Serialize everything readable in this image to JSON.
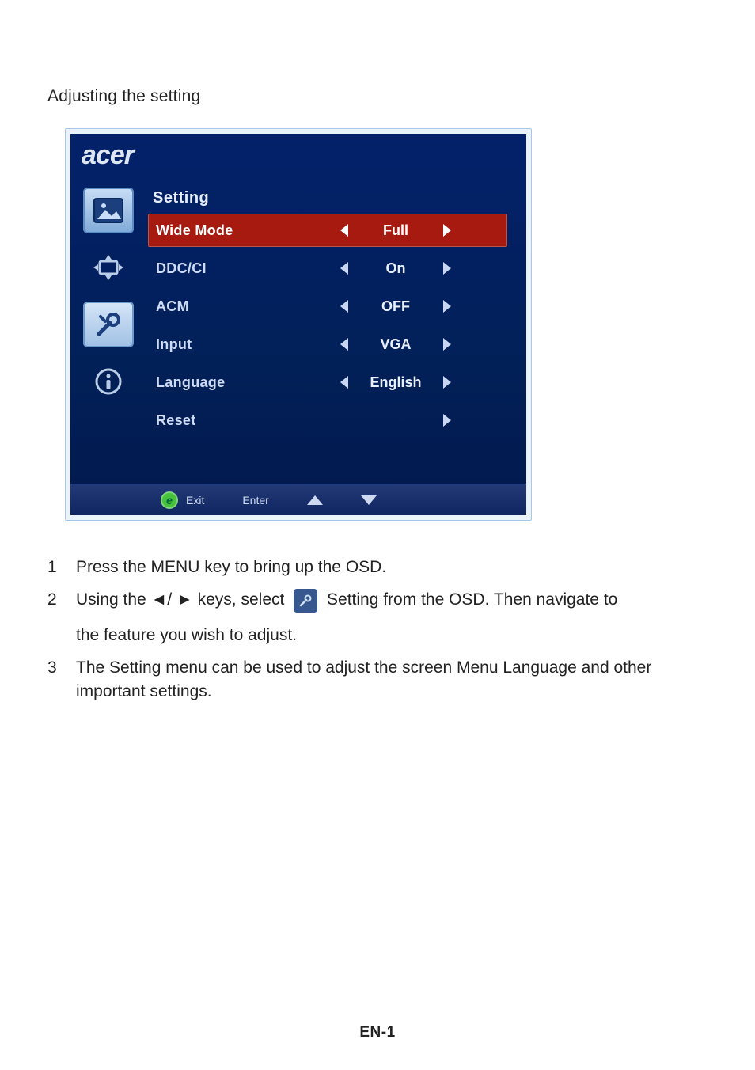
{
  "heading": "Adjusting the setting",
  "osd": {
    "brand": "acer",
    "menuTitle": "Setting",
    "rows": [
      {
        "label": "Wide Mode",
        "value": "Full",
        "hasLeft": true,
        "hasRight": true,
        "highlight": true
      },
      {
        "label": "DDC/CI",
        "value": "On",
        "hasLeft": true,
        "hasRight": true,
        "highlight": false
      },
      {
        "label": "ACM",
        "value": "OFF",
        "hasLeft": true,
        "hasRight": true,
        "highlight": false
      },
      {
        "label": "Input",
        "value": "VGA",
        "hasLeft": true,
        "hasRight": true,
        "highlight": false
      },
      {
        "label": "Language",
        "value": "English",
        "hasLeft": true,
        "hasRight": true,
        "highlight": false
      },
      {
        "label": "Reset",
        "value": "",
        "hasLeft": false,
        "hasRight": true,
        "highlight": false
      }
    ],
    "footer": {
      "exit": "Exit",
      "enter": "Enter"
    }
  },
  "steps": [
    {
      "n": "1",
      "text": "Press the MENU key to bring up the OSD."
    },
    {
      "n": "2",
      "pre": "Using the ◄/ ► keys, select ",
      "mid": " Setting from the OSD. Then navigate to",
      "tail": "the feature you wish to adjust."
    },
    {
      "n": "3",
      "text": "The Setting menu can be used to adjust the screen Menu Language and other important settings."
    }
  ],
  "pageLabel": "EN-1"
}
